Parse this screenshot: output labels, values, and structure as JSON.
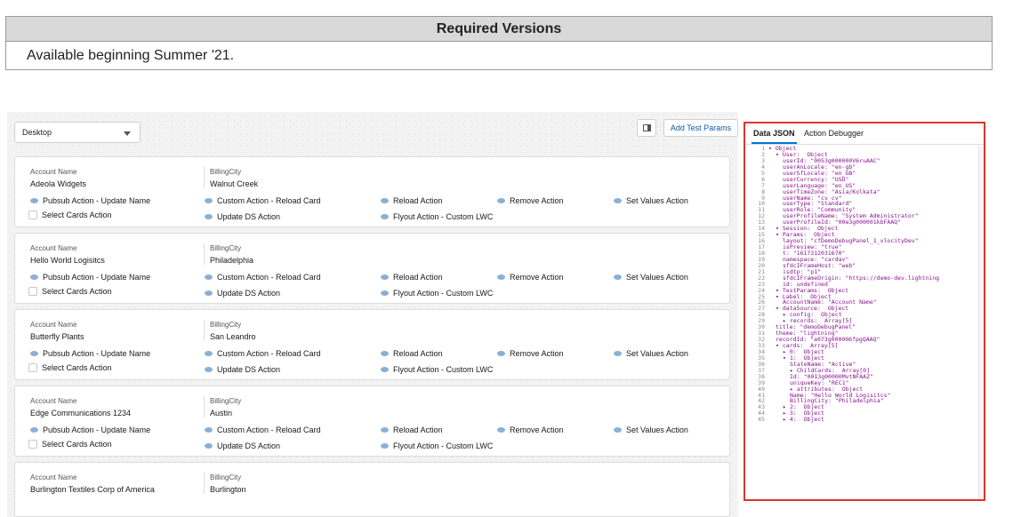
{
  "versions_table": {
    "header": "Required Versions",
    "value": "Available beginning Summer '21."
  },
  "toolbar": {
    "device_select_value": "Desktop",
    "add_test_params_label": "Add Test Params"
  },
  "cards": [
    {
      "field1_label": "Account Name",
      "field1_value": "Adeola Widgets",
      "field2_label": "BillingCity",
      "field2_value": "Walnut Creek",
      "actions_row1": [
        "Pubsub Action - Update Name",
        "Custom Action - Reload Card",
        "Reload Action",
        "Remove Action",
        "Set Values Action"
      ],
      "checkbox_label": "Select Cards Action",
      "actions_row2": [
        "Update DS Action",
        "Flyout Action - Custom LWC"
      ]
    },
    {
      "field1_label": "Account Name",
      "field1_value": "Hello World Logisitcs",
      "field2_label": "BillingCity",
      "field2_value": "Philadelphia",
      "actions_row1": [
        "Pubsub Action - Update Name",
        "Custom Action - Reload Card",
        "Reload Action",
        "Remove Action",
        "Set Values Action"
      ],
      "checkbox_label": "Select Cards Action",
      "actions_row2": [
        "Update DS Action",
        "Flyout Action - Custom LWC"
      ]
    },
    {
      "field1_label": "Account Name",
      "field1_value": "Butterfly Plants",
      "field2_label": "BillingCity",
      "field2_value": "San Leandro",
      "actions_row1": [
        "Pubsub Action - Update Name",
        "Custom Action - Reload Card",
        "Reload Action",
        "Remove Action",
        "Set Values Action"
      ],
      "checkbox_label": "Select Cards Action",
      "actions_row2": [
        "Update DS Action",
        "Flyout Action - Custom LWC"
      ]
    },
    {
      "field1_label": "Account Name",
      "field1_value": "Edge Communications 1234",
      "field2_label": "BillingCity",
      "field2_value": "Austin",
      "actions_row1": [
        "Pubsub Action - Update Name",
        "Custom Action - Reload Card",
        "Reload Action",
        "Remove Action",
        "Set Values Action"
      ],
      "checkbox_label": "Select Cards Action",
      "actions_row2": [
        "Update DS Action",
        "Flyout Action - Custom LWC"
      ]
    },
    {
      "field1_label": "Account Name",
      "field1_value": "Burlington Textiles Corp of America",
      "field2_label": "BillingCity",
      "field2_value": "Burlington"
    }
  ],
  "debug_panel": {
    "tabs": [
      "Data JSON",
      "Action Debugger"
    ],
    "json_lines": [
      {
        "n": "1",
        "indent": 0,
        "text": "▾ Object"
      },
      {
        "n": "2",
        "indent": 1,
        "text": "▾ User:  Object"
      },
      {
        "n": "3",
        "indent": 2,
        "text": "userId: \"0053g000000V6ruAAC\""
      },
      {
        "n": "4",
        "indent": 2,
        "text": "userAnLocale: \"en-gb\""
      },
      {
        "n": "5",
        "indent": 2,
        "text": "userSfLocale: \"en_GB\""
      },
      {
        "n": "6",
        "indent": 2,
        "text": "userCurrency: \"USD\""
      },
      {
        "n": "7",
        "indent": 2,
        "text": "userLanguage: \"en_US\""
      },
      {
        "n": "8",
        "indent": 2,
        "text": "userTimeZone: \"Asia/Kolkata\""
      },
      {
        "n": "9",
        "indent": 2,
        "text": "userName: \"cv cv\""
      },
      {
        "n": "10",
        "indent": 2,
        "text": "userType: \"Standard\""
      },
      {
        "n": "11",
        "indent": 2,
        "text": "userRole: \"Community\""
      },
      {
        "n": "12",
        "indent": 2,
        "text": "userProfileName: \"System Administrator\""
      },
      {
        "n": "13",
        "indent": 2,
        "text": "userProfileId: \"00e3g000001kbFAAQ\""
      },
      {
        "n": "14",
        "indent": 1,
        "text": "▾ Session:  Object"
      },
      {
        "n": "15",
        "indent": 1,
        "text": "▾ Params:  Object"
      },
      {
        "n": "16",
        "indent": 2,
        "text": "layout: \"cfDemoDebugPanel_1_vlocityDev\""
      },
      {
        "n": "17",
        "indent": 2,
        "text": "isPreview: \"true\""
      },
      {
        "n": "18",
        "indent": 2,
        "text": "t: \"1617312031670\""
      },
      {
        "n": "19",
        "indent": 2,
        "text": "namespace: \"cardav\""
      },
      {
        "n": "20",
        "indent": 2,
        "text": "sfdcIFrameHost: \"web\""
      },
      {
        "n": "21",
        "indent": 2,
        "text": "isdtp: \"p1\""
      },
      {
        "n": "22",
        "indent": 2,
        "text": "sfdcIFrameOrigin: \"https://demo-dev.lightning"
      },
      {
        "n": "23",
        "indent": 2,
        "text": "id: undefined"
      },
      {
        "n": "24",
        "indent": 1,
        "text": "▾ TestParams:  Object"
      },
      {
        "n": "25",
        "indent": 1,
        "text": "▾ Label:  Object"
      },
      {
        "n": "26",
        "indent": 2,
        "text": "AccountName: \"Account Name\""
      },
      {
        "n": "27",
        "indent": 1,
        "text": "▾ dataSource:  Object"
      },
      {
        "n": "28",
        "indent": 2,
        "text": "▸ config:  Object"
      },
      {
        "n": "29",
        "indent": 2,
        "text": "▸ records:  Array[5]"
      },
      {
        "n": "30",
        "indent": 1,
        "text": "title: \"demoDebugPanel\""
      },
      {
        "n": "31",
        "indent": 1,
        "text": "theme: \"lightning\""
      },
      {
        "n": "32",
        "indent": 1,
        "text": "recordId: \"a073g000006fpgQAAQ\""
      },
      {
        "n": "33",
        "indent": 1,
        "text": "▾ cards:  Array[5]"
      },
      {
        "n": "34",
        "indent": 2,
        "text": "▸ 0:  Object"
      },
      {
        "n": "35",
        "indent": 2,
        "text": "▾ 1:  Object"
      },
      {
        "n": "36",
        "indent": 3,
        "text": "StateName: \"Active\""
      },
      {
        "n": "37",
        "indent": 3,
        "text": "▸ ChildCards:  Array[0]"
      },
      {
        "n": "38",
        "indent": 3,
        "text": "Id: \"0013g00000MvtNFAAZ\""
      },
      {
        "n": "39",
        "indent": 3,
        "text": "uniqueKey: \"REC1\""
      },
      {
        "n": "40",
        "indent": 3,
        "text": "▸ attributes:  Object"
      },
      {
        "n": "41",
        "indent": 3,
        "text": "Name: \"Hello World Logisitcs\""
      },
      {
        "n": "42",
        "indent": 3,
        "text": "BillingCity: \"Philadelphia\""
      },
      {
        "n": "43",
        "indent": 2,
        "text": "▸ 2:  Object"
      },
      {
        "n": "44",
        "indent": 2,
        "text": "▸ 3:  Object"
      },
      {
        "n": "45",
        "indent": 2,
        "text": "▸ 4:  Object"
      }
    ]
  },
  "colors": {
    "highlight_border": "#d9362e",
    "action_icon": "#8ab0d4",
    "link_blue": "#0b5cab",
    "json_key": "#881391"
  }
}
